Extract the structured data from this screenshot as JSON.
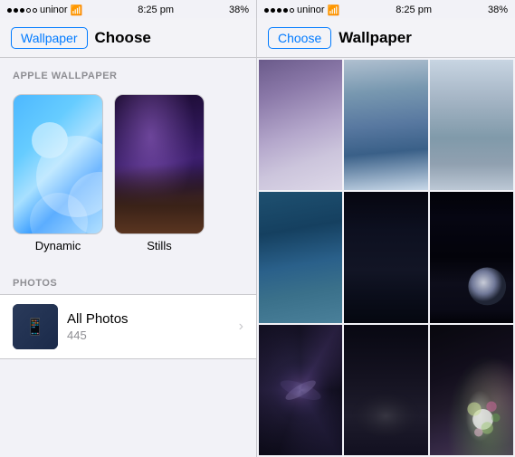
{
  "left": {
    "status": {
      "carrier": "uninor",
      "time": "8:25 pm",
      "battery": "38%"
    },
    "nav": {
      "back_label": "Wallpaper",
      "title": "Choose"
    },
    "apple_section": {
      "header": "APPLE WALLPAPER",
      "items": [
        {
          "id": "dynamic",
          "label": "Dynamic"
        },
        {
          "id": "stills",
          "label": "Stills"
        }
      ]
    },
    "photos_section": {
      "header": "PHOTOS",
      "label": "All Photos",
      "count": "445"
    }
  },
  "right": {
    "status": {
      "carrier": "uninor",
      "time": "8:25 pm",
      "battery": "38%"
    },
    "nav": {
      "back_label": "Choose",
      "title": "Wallpaper"
    },
    "gallery": {
      "items": [
        {
          "id": "galaxy-sky",
          "row": 1
        },
        {
          "id": "snowy-forest",
          "row": 1
        },
        {
          "id": "snowy-mountains",
          "row": 1
        },
        {
          "id": "ocean-waves",
          "row": 2
        },
        {
          "id": "dark-desert",
          "row": 2
        },
        {
          "id": "earth-space",
          "row": 2
        },
        {
          "id": "galaxy-spiral",
          "row": 3
        },
        {
          "id": "moon-surface",
          "row": 3
        },
        {
          "id": "flowers",
          "row": 3
        }
      ]
    }
  }
}
